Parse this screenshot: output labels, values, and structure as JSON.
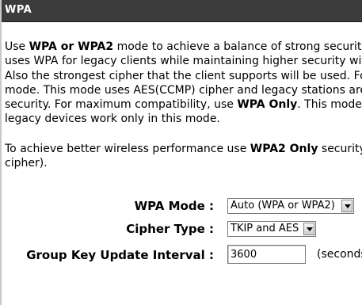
{
  "header": {
    "title": "WPA"
  },
  "intro": {
    "lines": [
      [
        {
          "t": "Use "
        },
        {
          "t": "WPA or WPA2",
          "b": true
        },
        {
          "t": " mode to achieve a balance of strong security"
        }
      ],
      [
        {
          "t": "uses WPA for legacy clients while maintaining higher security with"
        }
      ],
      [
        {
          "t": "Also the strongest cipher that the client supports will be used. For"
        }
      ],
      [
        {
          "t": "mode. This mode uses AES(CCMP) cipher and legacy stations are"
        }
      ],
      [
        {
          "t": "security. For maximum compatibility, use "
        },
        {
          "t": "WPA Only",
          "b": true
        },
        {
          "t": ". This mode"
        }
      ],
      [
        {
          "t": "legacy devices work only in this mode."
        }
      ]
    ]
  },
  "performance": {
    "lines": [
      [
        {
          "t": "To achieve better wireless performance use "
        },
        {
          "t": "WPA2 Only",
          "b": true
        },
        {
          "t": " security"
        }
      ],
      [
        {
          "t": "cipher)."
        }
      ]
    ]
  },
  "form": {
    "wpa_mode_label": "WPA Mode :",
    "wpa_mode_value": "Auto (WPA or WPA2)",
    "cipher_type_label": "Cipher Type :",
    "cipher_type_value": "TKIP and AES",
    "group_key_label": "Group Key Update Interval :",
    "group_key_value": "3600",
    "group_key_unit": "(seconds)"
  }
}
